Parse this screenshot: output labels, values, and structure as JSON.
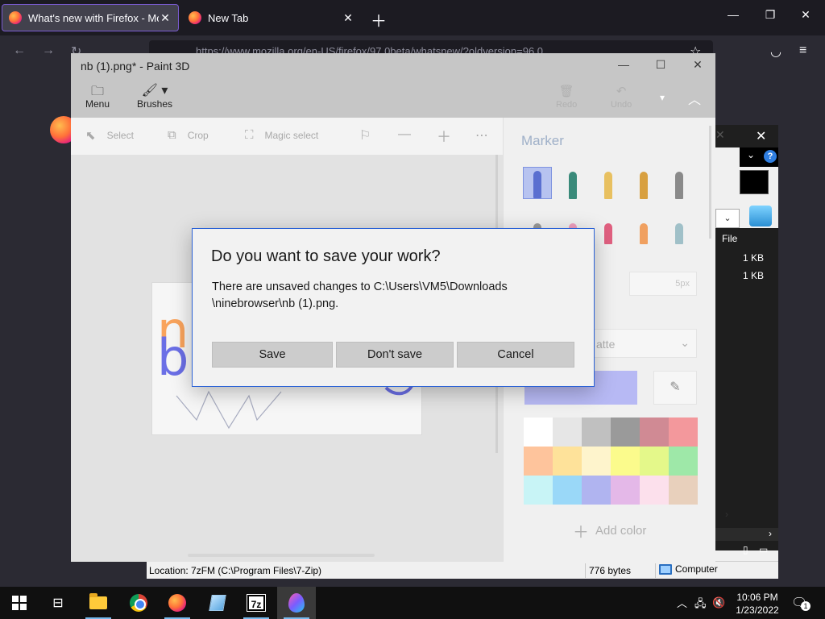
{
  "firefox": {
    "tabs": [
      {
        "label": "What's new with Firefox - More"
      },
      {
        "label": "New Tab"
      }
    ],
    "url": "https://www.mozilla.org/en-US/firefox/97.0beta/whatsnew/?oldversion=96.0"
  },
  "sevenzip": {
    "column_header": "File",
    "sizes": [
      "1 KB",
      "1 KB"
    ],
    "status": {
      "location": "Location: 7zFM (C:\\Program Files\\7-Zip)",
      "bytes": "776 bytes",
      "computer": "Computer"
    }
  },
  "paint3d": {
    "title": "nb (1).png* - Paint 3D",
    "ribbon": {
      "menu": "Menu",
      "brushes": "Brushes",
      "redo": "Redo",
      "undo": "Undo"
    },
    "toolbar": {
      "select": "Select",
      "crop": "Crop",
      "magic_select": "Magic select"
    },
    "panel": {
      "title": "Marker",
      "size": "5px",
      "palette_label": "atte",
      "add_color": "Add color",
      "current_color": "#b7b9f4",
      "brush_colors": [
        "#5a6fd0",
        "#3a8a7a",
        "#e8c060",
        "#d8a040",
        "#8a8a8a",
        "#9a9a9a",
        "#f0a0c0",
        "#e06080",
        "#f0a060",
        "#a0c0c8"
      ],
      "swatches": [
        "#ffffff",
        "#e6e6e6",
        "#c0c0c0",
        "#9a9a9a",
        "#d08a94",
        "#f3989c",
        "#fec49c",
        "#fee29a",
        "#fef4cc",
        "#fbfb8c",
        "#e4f88a",
        "#9ee8a8",
        "#c8f4f6",
        "#9ad8f8",
        "#b0b4f0",
        "#e4b8e8",
        "#fce0ec",
        "#e8d0bc"
      ]
    },
    "canvas": {
      "letters": [
        "n",
        "b"
      ],
      "colors": [
        "#f9a35c",
        "#6b6fe6"
      ]
    }
  },
  "dialog": {
    "title": "Do you want to save your work?",
    "message": "There are unsaved changes to C:\\Users\\VM5\\Downloads\n\\ninebrowser\\nb (1).png.",
    "buttons": {
      "save": "Save",
      "dont_save": "Don't save",
      "cancel": "Cancel"
    }
  },
  "taskbar": {
    "clock_time": "10:06 PM",
    "clock_date": "1/23/2022",
    "sevenzip_label": "7z",
    "notification_count": "1",
    "accent": "#76b9ed"
  }
}
